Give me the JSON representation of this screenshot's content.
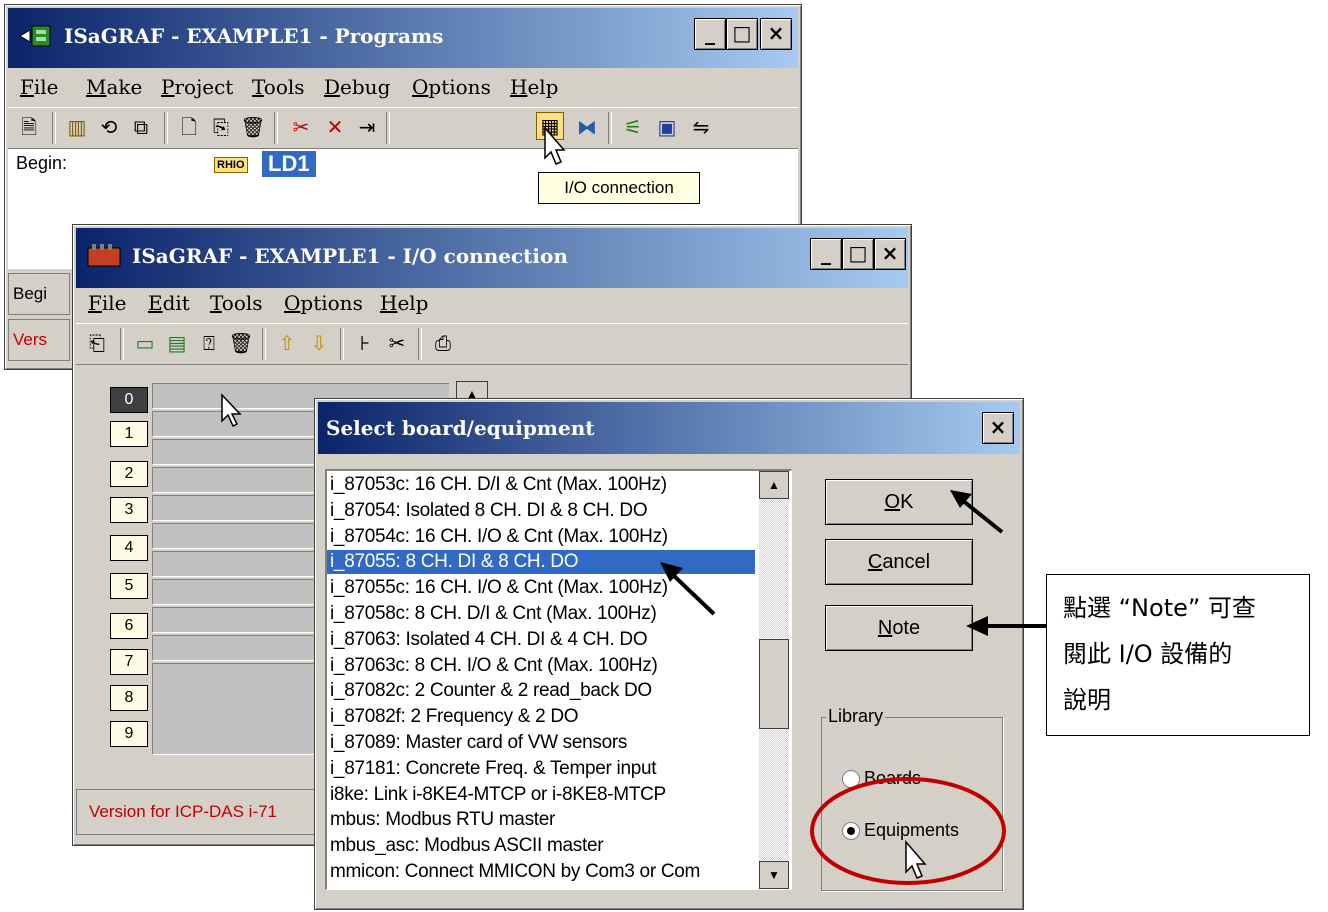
{
  "programs_window": {
    "title": "ISaGRAF - EXAMPLE1 - Programs",
    "menu": [
      "File",
      "Make",
      "Project",
      "Tools",
      "Debug",
      "Options",
      "Help"
    ],
    "begin_label": "Begin:",
    "program_badge": "RHIO",
    "program_name": "LD1",
    "tooltip": "I/O connection",
    "status_left": "Begi",
    "version_left": "Vers"
  },
  "io_window": {
    "title": "ISaGRAF - EXAMPLE1 - I/O connection",
    "menu": [
      "File",
      "Edit",
      "Tools",
      "Options",
      "Help"
    ],
    "slots": [
      "0",
      "1",
      "2",
      "3",
      "4",
      "5",
      "6",
      "7",
      "8",
      "9"
    ],
    "selected_slot": "0",
    "status": "Version for ICP-DAS i-71"
  },
  "dialog": {
    "title": "Select board/equipment",
    "items": [
      "i_87053c: 16 CH. D/I  & Cnt (Max. 100Hz)",
      "i_87054: Isolated 8 CH. DI & 8 CH. DO",
      "i_87054c: 16 CH. I/O  & Cnt (Max. 100Hz)",
      "i_87055: 8 CH. DI & 8 CH. DO",
      "i_87055c: 16 CH. I/O  & Cnt (Max. 100Hz)",
      "i_87058c: 8 CH. D/I  & Cnt (Max. 100Hz)",
      "i_87063: Isolated 4 CH. DI & 4 CH. DO",
      "i_87063c: 8 CH. I/O  & Cnt (Max. 100Hz)",
      "i_87082c: 2 Counter & 2 read_back DO",
      "i_87082f: 2 Frequency & 2 DO",
      "i_87089: Master card of VW sensors",
      "i_87181: Concrete Freq. & Temper input",
      "i8ke: Link i-8KE4-MTCP or i-8KE8-MTCP",
      "mbus: Modbus RTU master",
      "mbus_asc: Modbus ASCII master",
      "mmicon: Connect MMICON by Com3 or Com"
    ],
    "selected_index": 3,
    "ok_label": "OK",
    "cancel_label": "Cancel",
    "note_label": "Note",
    "library_label": "Library",
    "radio_boards": "Boards",
    "radio_equipments": "Equipments",
    "selected_library": "Equipments"
  },
  "callout": {
    "line1": "點選 “Note” 可查",
    "line2": "閱此 I/O 設備的",
    "line3": "說明"
  },
  "colors": {
    "titlebar_start": "#0a246a",
    "titlebar_end": "#a6caf0",
    "selection": "#316ac5",
    "annotation_circle": "#c00000",
    "status_text": "#c00000"
  }
}
